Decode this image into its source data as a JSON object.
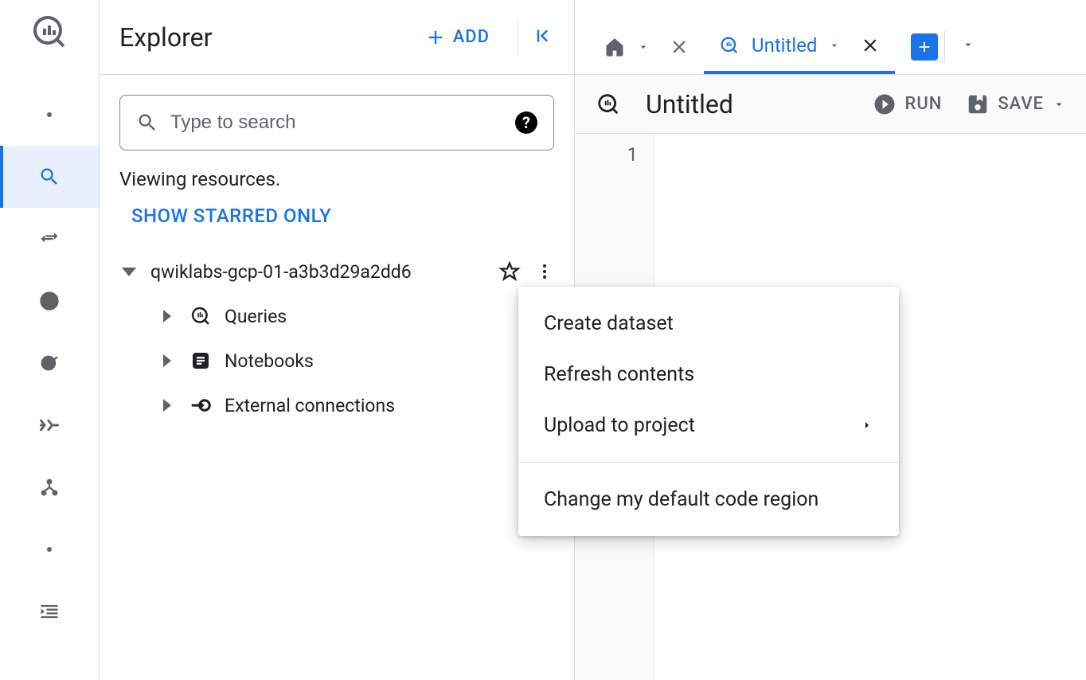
{
  "explorer": {
    "title": "Explorer",
    "add_label": "ADD",
    "search_placeholder": "Type to search",
    "viewing_text": "Viewing resources.",
    "show_starred_label": "SHOW STARRED ONLY",
    "project": {
      "name": "qwiklabs-gcp-01-a3b3d29a2dd6",
      "children": [
        {
          "label": "Queries"
        },
        {
          "label": "Notebooks"
        },
        {
          "label": "External connections"
        }
      ]
    }
  },
  "tabs": {
    "untitled_label": "Untitled"
  },
  "toolbar": {
    "doc_title": "Untitled",
    "run_label": "RUN",
    "save_label": "SAVE"
  },
  "editor": {
    "line_number": "1"
  },
  "context_menu": {
    "items_a": [
      {
        "label": "Create dataset",
        "submenu": false
      },
      {
        "label": "Refresh contents",
        "submenu": false
      },
      {
        "label": "Upload to project",
        "submenu": true
      }
    ],
    "items_b": [
      {
        "label": "Change my default code region",
        "submenu": false
      }
    ]
  }
}
